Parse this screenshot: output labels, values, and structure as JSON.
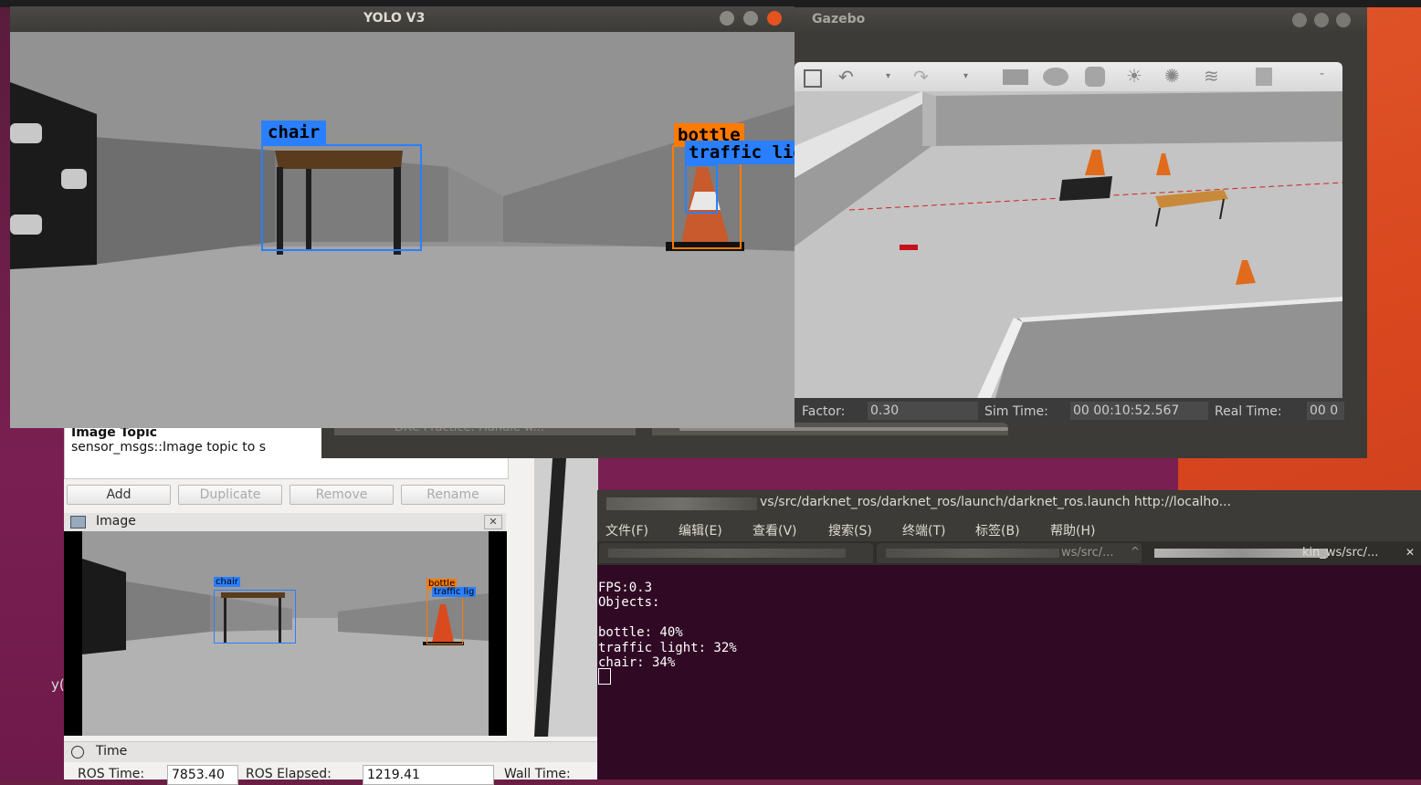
{
  "yolo_window": {
    "title": "YOLO V3",
    "detections": [
      {
        "label": "chair",
        "color": "#2a7fff"
      },
      {
        "label": "bottle",
        "color": "#ff7a00"
      },
      {
        "label": "traffic lig",
        "color": "#2a7fff"
      }
    ]
  },
  "gazebo": {
    "title": "Gazebo",
    "status": {
      "factor_label": "Factor:",
      "factor_value": "0.30",
      "sim_time_label": "Sim Time:",
      "sim_time_value": "00 00:10:52.567",
      "real_time_label": "Real Time:",
      "real_time_value": "00 0"
    },
    "toolbar_icons": [
      "select-icon",
      "undo-icon",
      "redo-icon",
      "box-icon",
      "sphere-icon",
      "cylinder-icon",
      "sun-light-icon",
      "point-light-icon",
      "directional-light-icon",
      "copy-icon"
    ],
    "bottom_tab": "DRC Practice: Handle w..."
  },
  "rviz": {
    "description_title": "Image Topic",
    "description_text": "sensor_msgs::Image topic to s",
    "buttons": {
      "add": "Add",
      "duplicate": "Duplicate",
      "remove": "Remove",
      "rename": "Rename"
    },
    "image_panel_title": "Image",
    "image_detections": [
      {
        "label": "chair"
      },
      {
        "label": "bottle"
      },
      {
        "label": "traffic lig"
      }
    ],
    "time_panel_title": "Time",
    "ros_time_label": "ROS Time:",
    "ros_time_value": "7853.40",
    "ros_elapsed_label": "ROS Elapsed:",
    "ros_elapsed_value": "1219.41",
    "wall_time_label": "Wall Time:",
    "side_text": "y("
  },
  "terminal": {
    "title": "vs/src/darknet_ros/darknet_ros/launch/darknet_ros.launch http://localho...",
    "menu": [
      "文件(F)",
      "编辑(E)",
      "查看(V)",
      "搜索(S)",
      "终端(T)",
      "标签(B)",
      "帮助(H)"
    ],
    "tabs": [
      "ws/src/...",
      "kin_ws/src/..."
    ],
    "output": [
      "FPS:0.3",
      "Objects:",
      "",
      "bottle: 40%",
      "traffic light: 32%",
      "chair: 34%"
    ]
  }
}
